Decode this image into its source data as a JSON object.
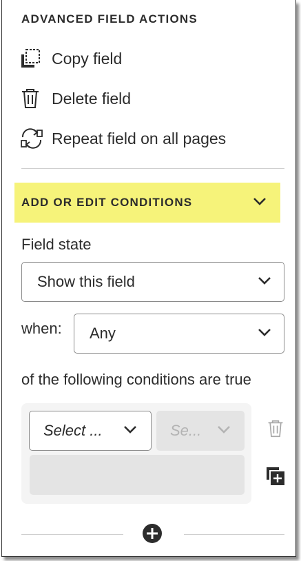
{
  "advanced": {
    "title": "ADVANCED FIELD ACTIONS",
    "actions": [
      {
        "label": "Copy field",
        "icon": "copy-field-icon"
      },
      {
        "label": "Delete field",
        "icon": "trash-icon"
      },
      {
        "label": "Repeat field on all pages",
        "icon": "repeat-pages-icon"
      }
    ]
  },
  "conditions": {
    "title": "ADD OR EDIT CONDITIONS",
    "highlight_color": "#f6f37a",
    "field_state_label": "Field state",
    "field_state_value": "Show this field",
    "when_label": "when:",
    "when_value": "Any",
    "following_text": "of the following conditions are true",
    "rule": {
      "field_select": "Select ...",
      "operator_select": "Se..."
    }
  }
}
